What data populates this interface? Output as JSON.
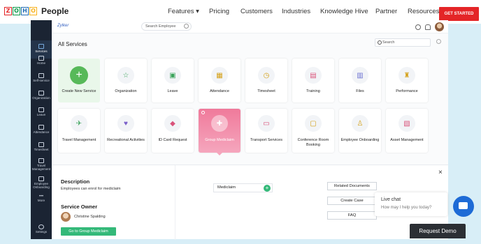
{
  "site": {
    "logo_letters": [
      "Z",
      "O",
      "H",
      "O"
    ],
    "logo_colors": [
      "#e42527",
      "#089949",
      "#226db4",
      "#f9b21d"
    ],
    "product": "People",
    "nav": [
      "Features ▾",
      "Pricing",
      "Customers",
      "Industries",
      "Knowledge Hive",
      "Partner",
      "Resources"
    ],
    "cta": "GET STARTED"
  },
  "app": {
    "brand": "Zylker",
    "search_placeholder": "Search Employee",
    "sidebar": [
      {
        "label": "Services",
        "active": true
      },
      {
        "label": "Home"
      },
      {
        "label": "Self-service"
      },
      {
        "label": "Organization"
      },
      {
        "label": "Leave"
      },
      {
        "label": "Attendance"
      },
      {
        "label": "Timesheet"
      },
      {
        "label": "Travel Management"
      },
      {
        "label": "Employee Onboarding"
      },
      {
        "label": "More"
      },
      {
        "label": "Settings"
      }
    ],
    "section_title": "All Services",
    "services_search": "Search",
    "services": [
      {
        "label": "Create New Service",
        "icon": "plus-icon"
      },
      {
        "label": "Organization",
        "icon": "star-icon"
      },
      {
        "label": "Leave",
        "icon": "gift-icon"
      },
      {
        "label": "Attendance",
        "icon": "calendar-check-icon"
      },
      {
        "label": "Timesheet",
        "icon": "clock-icon"
      },
      {
        "label": "Training",
        "icon": "book-icon"
      },
      {
        "label": "Files",
        "icon": "folder-icon"
      },
      {
        "label": "Performance",
        "icon": "trophy-icon"
      },
      {
        "label": "Travel Management",
        "icon": "plane-icon"
      },
      {
        "label": "Recreational Activities",
        "icon": "heart-icon"
      },
      {
        "label": "ID Card Request",
        "icon": "tag-icon"
      },
      {
        "label": "Group Mediclaim",
        "icon": "medical-bag-icon",
        "active": true
      },
      {
        "label": "Transport Services",
        "icon": "bus-icon"
      },
      {
        "label": "Conference Room Booking",
        "icon": "presentation-icon"
      },
      {
        "label": "Employee Onboarding",
        "icon": "person-icon"
      },
      {
        "label": "Asset Management",
        "icon": "box-icon"
      }
    ],
    "detail": {
      "description_title": "Description",
      "description_text": "Employees can enrol for mediclaim",
      "owner_title": "Service Owner",
      "owner_name": "Christine Spalding",
      "go_button": "Go to Group Mediclaim",
      "form_item": "Mediclaim",
      "side_buttons": [
        "Related Documents",
        "Create Case",
        "FAQ"
      ],
      "close": "×"
    }
  },
  "chat": {
    "title": "Live chat",
    "subtitle": "How may I help you today?"
  },
  "request_demo": "Request Demo"
}
